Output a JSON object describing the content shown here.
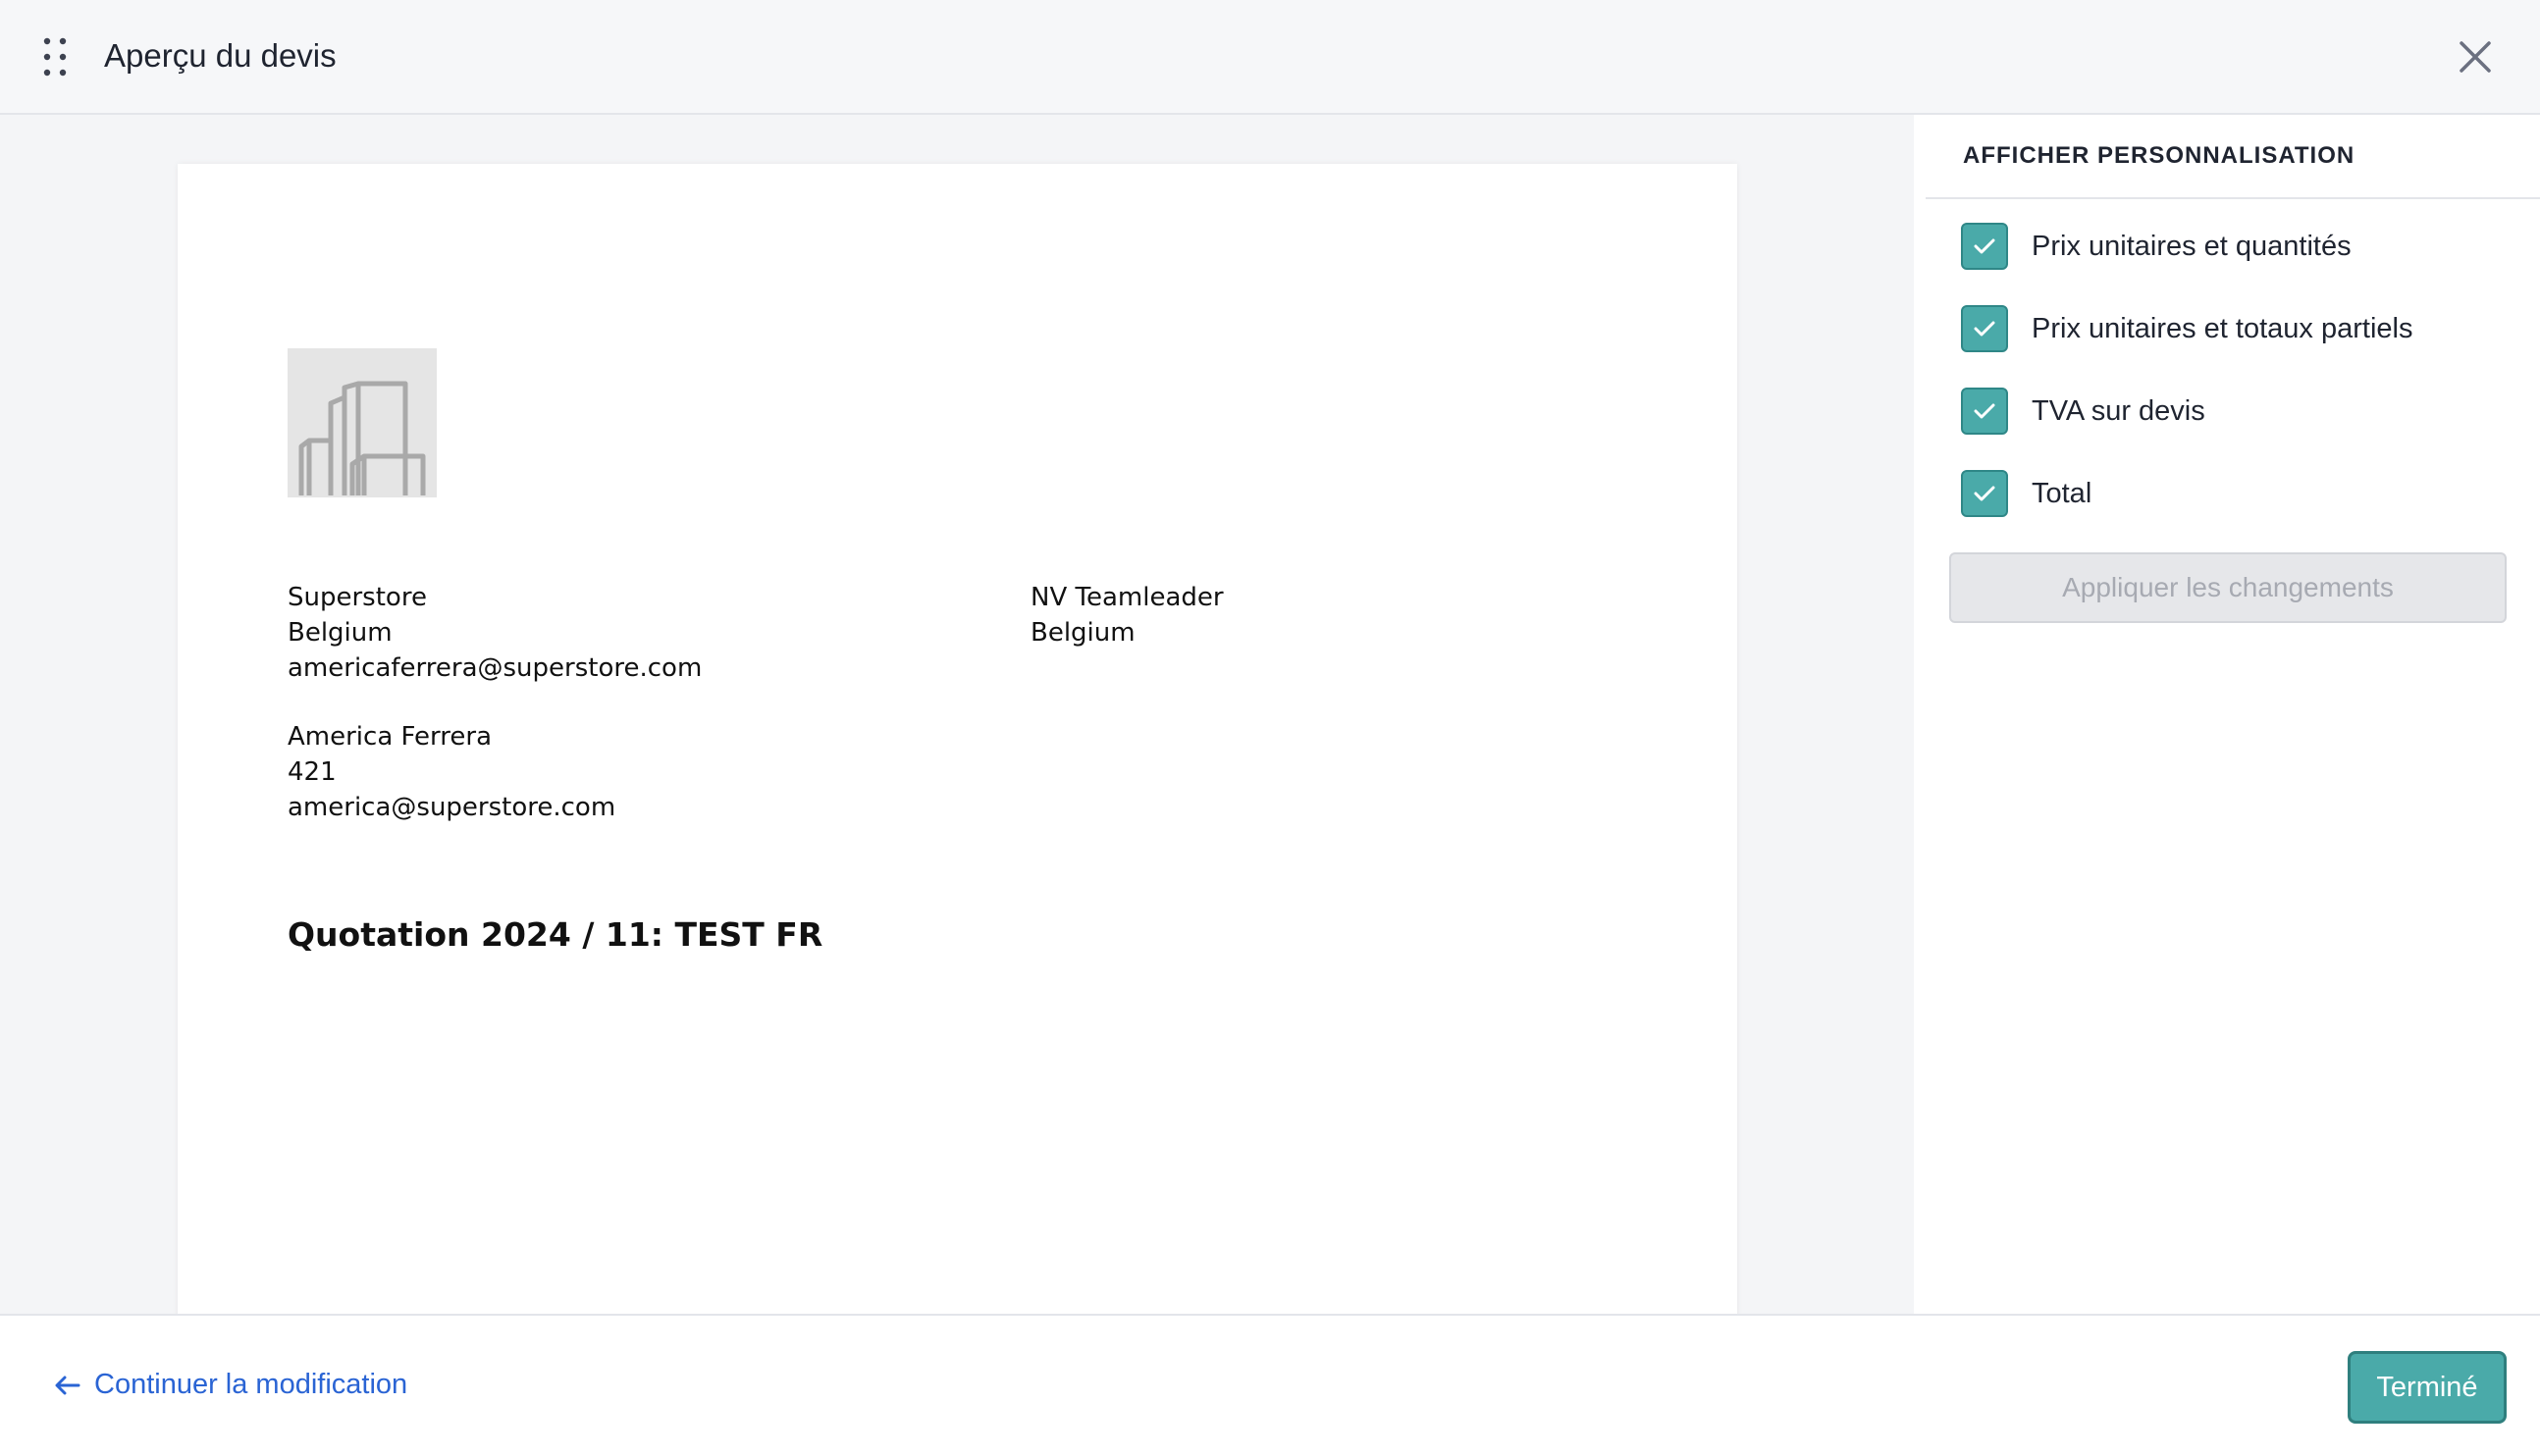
{
  "header": {
    "title": "Aperçu du devis",
    "drag_icon": "drag-handle-icon",
    "close_icon": "close-icon"
  },
  "document": {
    "logo_icon": "building-placeholder-icon",
    "sender": {
      "name": "Superstore",
      "country": "Belgium",
      "email": "americaferrera@superstore.com"
    },
    "recipient": {
      "name": "NV Teamleader",
      "country": "Belgium"
    },
    "contact": {
      "name": "America Ferrera",
      "number": "421",
      "email": "america@superstore.com"
    },
    "quote_title": "Quotation 2024 / 11: TEST FR"
  },
  "panel": {
    "heading": "AFFICHER PERSONNALISATION",
    "options": [
      {
        "label": "Prix unitaires et quantités",
        "checked": true
      },
      {
        "label": "Prix unitaires et totaux partiels",
        "checked": true
      },
      {
        "label": "TVA sur devis",
        "checked": true
      },
      {
        "label": "Total",
        "checked": true
      }
    ],
    "apply_label": "Appliquer les changements"
  },
  "footer": {
    "back_label": "Continuer la modification",
    "back_icon": "arrow-left-icon",
    "done_label": "Terminé"
  },
  "colors": {
    "accent": "#4aaaa9",
    "link": "#2a64d4",
    "header_bg": "#f6f7f9",
    "preview_bg": "#f4f5f7"
  }
}
